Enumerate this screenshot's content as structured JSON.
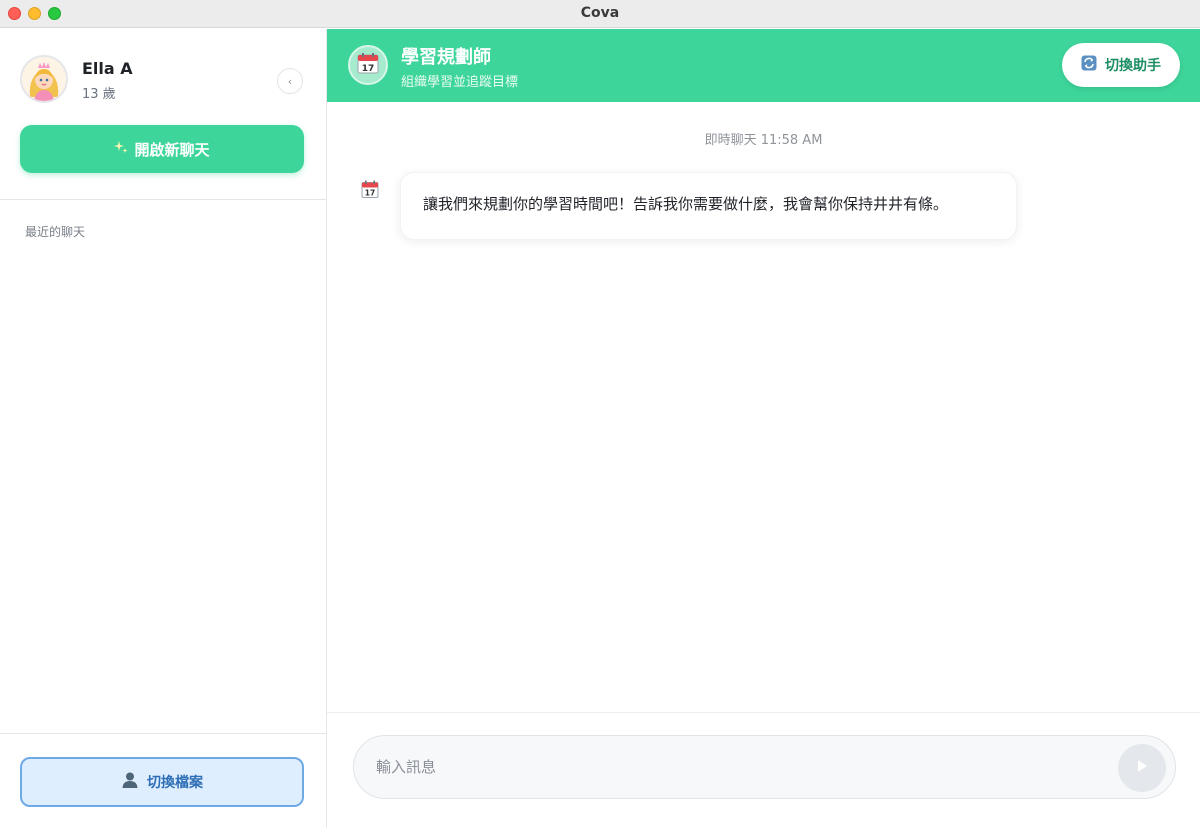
{
  "window": {
    "title": "Cova"
  },
  "sidebar": {
    "user": {
      "name": "Ella A",
      "age": "13 歲"
    },
    "new_chat": {
      "icon": "sparkles-icon",
      "label": "開啟新聊天"
    },
    "recent_label": "最近的聊天",
    "switch_profile": {
      "icon": "user-icon",
      "label": "切換檔案"
    }
  },
  "header": {
    "assistant_name": "學習規劃師",
    "assistant_desc": "組織學習並追蹤目標",
    "switch_assistant_label": "切換助手"
  },
  "chat": {
    "timestamp": "即時聊天 11:58 AM",
    "messages": [
      {
        "sender": "assistant",
        "icon": "calendar-icon",
        "text": "讓我們來規劃你的學習時間吧！告訴我你需要做什麼，我會幫你保持井井有條。"
      }
    ]
  },
  "input": {
    "placeholder": "輸入訊息",
    "value": ""
  },
  "colors": {
    "accent": "#3dd59a",
    "profile_button_bg": "#dfeeff",
    "profile_button_border": "#6ea9e6"
  }
}
